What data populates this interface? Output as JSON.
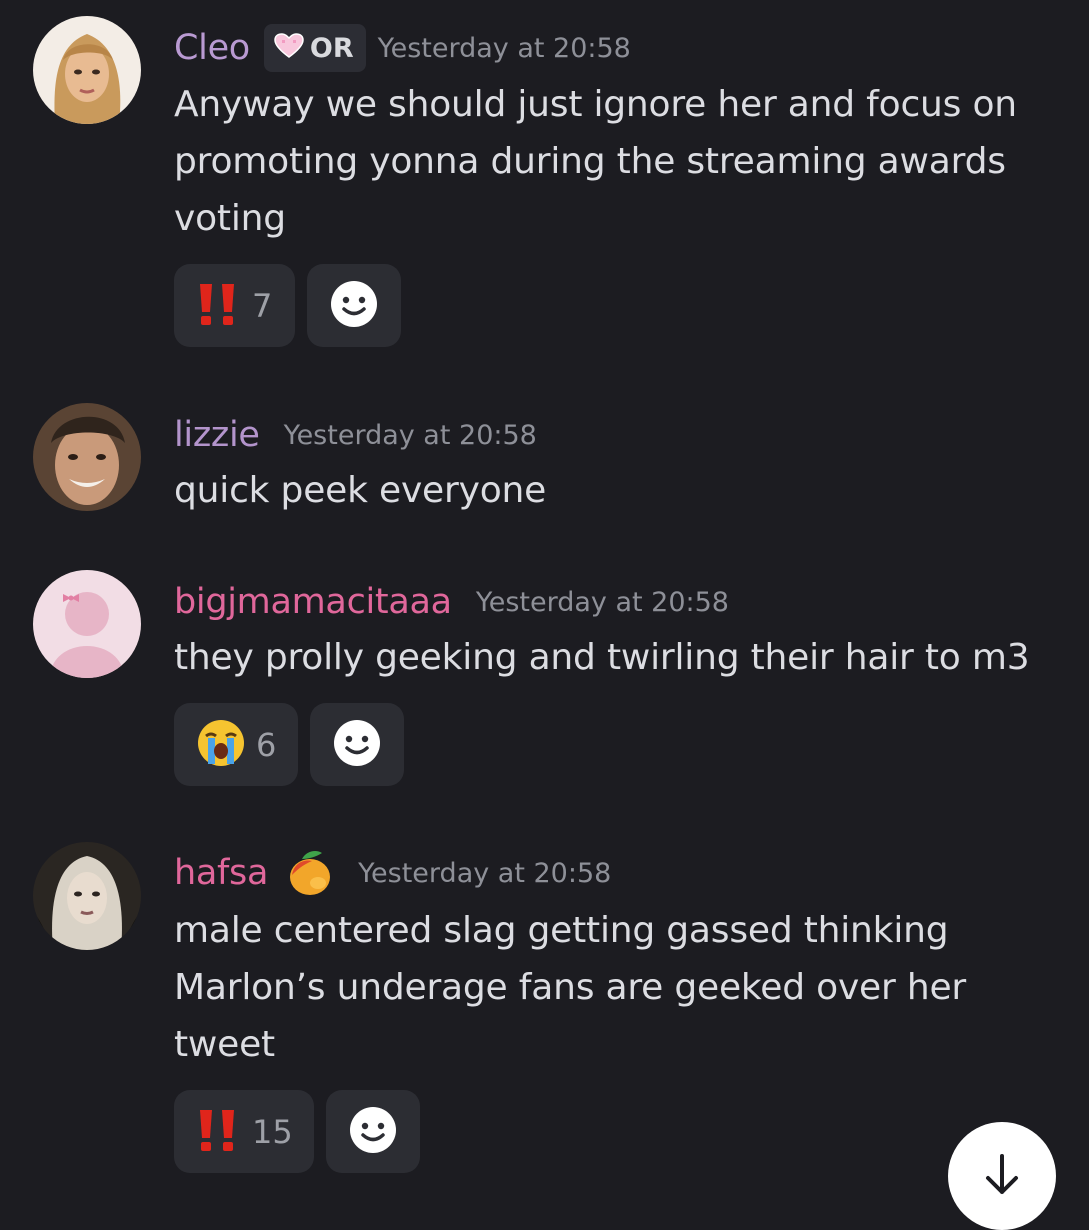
{
  "messages": [
    {
      "username": "Cleo",
      "username_color": "#b99ad2",
      "role_tag": {
        "label": "OR",
        "icon": "pink-heart-icon"
      },
      "timestamp": "Yesterday at 20:58",
      "text": "Anyway we should just ignore her and focus on promoting yonna during the streaming awards voting",
      "reactions": [
        {
          "emoji": "double-exclamation-icon",
          "count": "7"
        }
      ]
    },
    {
      "username": "lizzie",
      "username_color": "#b394cc",
      "timestamp": "Yesterday at 20:58",
      "text": "quick peek everyone",
      "reactions": []
    },
    {
      "username": "bigjmamacitaaa",
      "username_color": "#e0679b",
      "timestamp": "Yesterday at 20:58",
      "text": "they prolly geeking and twirling their hair to m3",
      "reactions": [
        {
          "emoji": "loudly-crying-face-icon",
          "count": "6"
        }
      ]
    },
    {
      "username": "hafsa",
      "username_color": "#e0679b",
      "username_emoji": "mango-icon",
      "timestamp": "Yesterday at 20:58",
      "text": "male centered slag getting gassed thinking Marlon’s underage fans are geeked over her tweet",
      "reactions": [
        {
          "emoji": "double-exclamation-icon",
          "count": "15"
        }
      ]
    }
  ],
  "scroll_button": {
    "icon": "arrow-down-icon"
  }
}
